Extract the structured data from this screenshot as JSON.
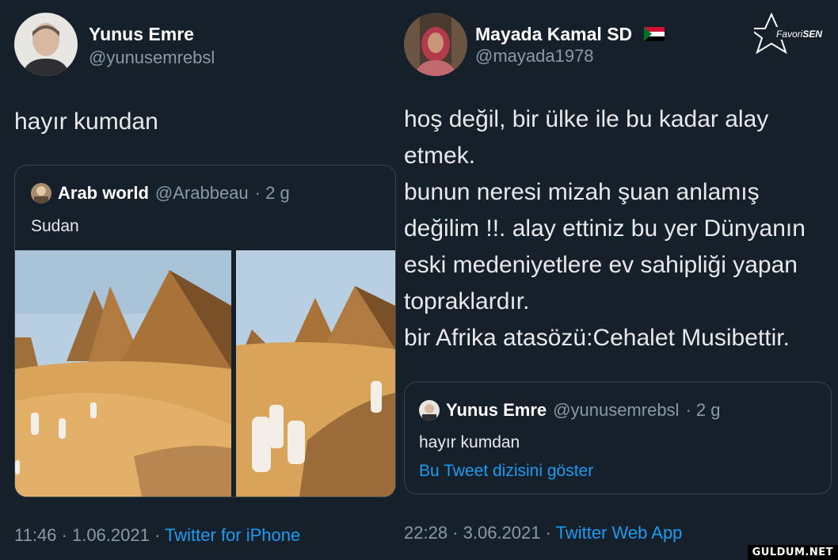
{
  "left_tweet": {
    "author_name": "Yunus Emre",
    "author_handle": "@yunusemrebsl",
    "text": "hayır kumdan",
    "quoted": {
      "author_name": "Arab world",
      "author_handle": "@Arabbeau",
      "time_ago": "· 2 g",
      "text": "Sudan"
    },
    "footer": {
      "time": "11:46 · 1.06.2021 ·",
      "source": "Twitter for iPhone"
    }
  },
  "right_tweet": {
    "author_name": "Mayada Kamal SD",
    "author_handle": "@mayada1978",
    "text_lines": [
      "hoş değil, bir ülke ile bu kadar alay",
      "etmek.",
      "bunun neresi mizah şuan anlamış",
      "değilim !!. alay ettiniz bu yer Dünyanın",
      "eski medeniyetlere ev sahipliği yapan",
      "topraklardır.",
      "bir Afrika atasözü:Cehalet Musibettir."
    ],
    "quoted": {
      "author_name": "Yunus Emre",
      "author_handle": "@yunusemrebsl",
      "time_ago": "· 2 g",
      "text": "hayır kumdan",
      "thread_link": "Bu Tweet dizisini göster"
    },
    "footer": {
      "time": "22:28 · 3.06.2021 ·",
      "source": "Twitter Web App"
    }
  },
  "watermarks": {
    "top_logo": "FavoriSEN",
    "bottom": "GULDUM.NET"
  },
  "colors": {
    "background": "#15202b",
    "link": "#1d9bf0",
    "muted": "#8b98a5",
    "sand": "#d9a45a",
    "sky": "#b7cfe0"
  }
}
